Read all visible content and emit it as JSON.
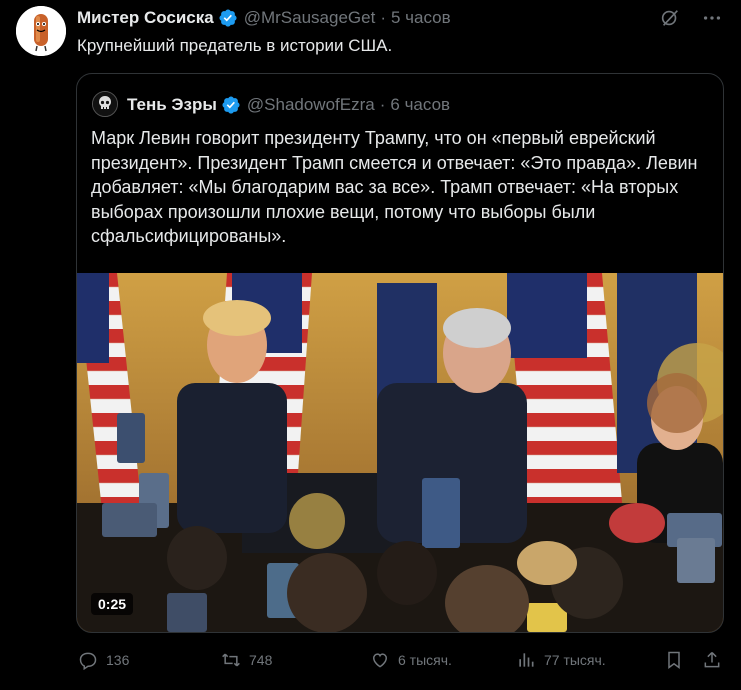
{
  "tweet": {
    "author_name": "Мистер Сосиска",
    "handle": "@MrSausageGet",
    "time": "5 часов",
    "text": "Крупнейший предатель в истории США.",
    "icons": [
      "grok-icon",
      "more-icon",
      "verified-badge-icon"
    ]
  },
  "quote": {
    "author_name": "Тень Эзры",
    "handle": "@ShadowofEzra",
    "time": "6 часов",
    "text": "Марк Левин говорит президенту Трампу, что он «первый еврейский президент». Президент Трамп смеется и отвечает: «Это правда». Левин добавляет: «Мы благодарим вас за все». Трамп отвечает: «На вторых выборах произошли плохие вещи, потому что выборы были сфальсифицированы».",
    "video_duration": "0:25"
  },
  "actions": {
    "replies": "136",
    "reposts": "748",
    "likes": "6 тысяч.",
    "views": "77 тысяч."
  },
  "colors": {
    "background": "#000000",
    "text": "#e7e9ea",
    "secondary": "#71767b",
    "verified": "#1d9bf0",
    "border": "#2f3336"
  }
}
